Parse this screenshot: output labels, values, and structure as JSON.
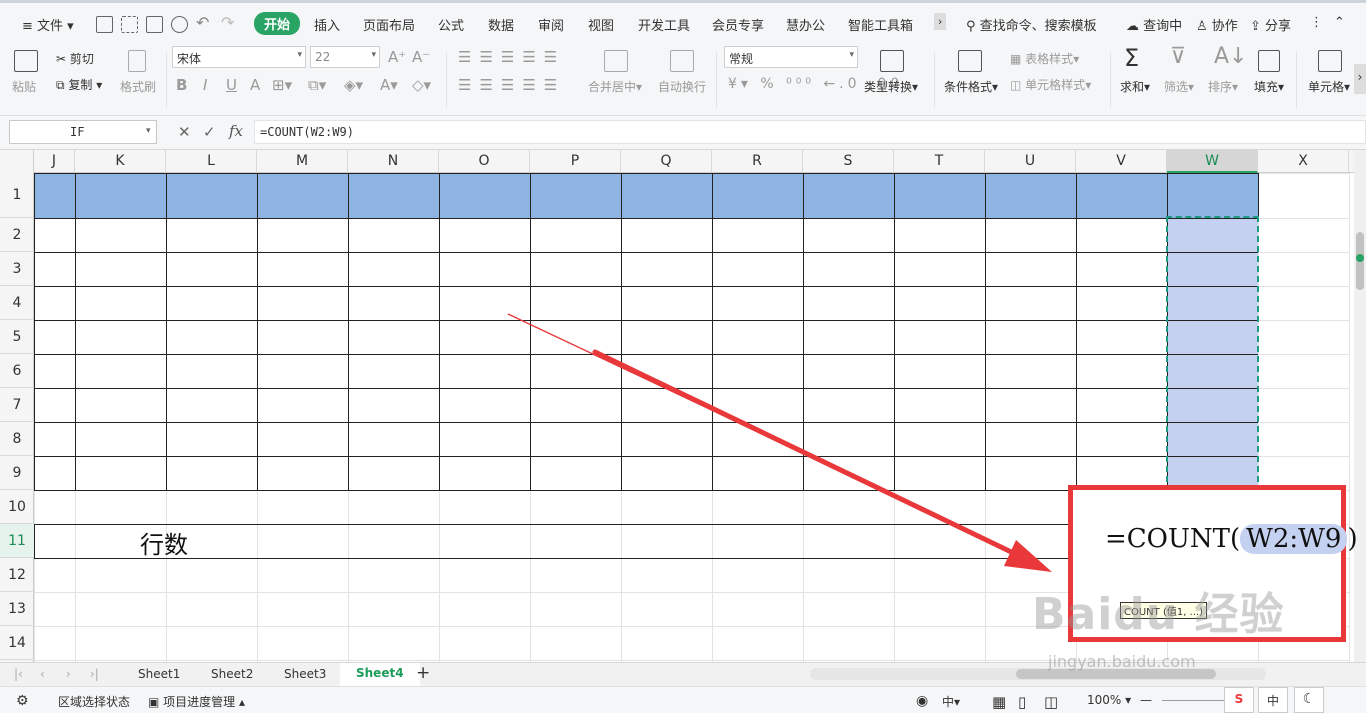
{
  "menu": {
    "file": "文件",
    "items": [
      "开始",
      "插入",
      "页面布局",
      "公式",
      "数据",
      "审阅",
      "视图",
      "开发工具",
      "会员专享",
      "慧办公",
      "智能工具箱"
    ],
    "search": "查找命令、搜索模板",
    "search_center": "查询中",
    "collab": "协作",
    "share": "分享"
  },
  "ribbon": {
    "paste": "粘贴",
    "cut": "剪切",
    "copy": "复制",
    "format_painter": "格式刷",
    "font": "宋体",
    "size": "22",
    "merge": "合并居中",
    "wrap": "自动换行",
    "numfmt": "常规",
    "type_convert": "类型转换",
    "cond_format": "条件格式",
    "table_style": "表格样式",
    "cell_style": "单元格样式",
    "sum": "求和",
    "filter": "筛选",
    "sort": "排序",
    "fill": "填充",
    "cell": "单元格"
  },
  "formula_bar": {
    "name_box": "IF",
    "fx": "fx",
    "formula": "=COUNT(W2:W9)"
  },
  "columns": [
    "J",
    "K",
    "L",
    "M",
    "N",
    "O",
    "P",
    "Q",
    "R",
    "S",
    "T",
    "U",
    "V",
    "W",
    "X"
  ],
  "rows": [
    "1",
    "2",
    "3",
    "4",
    "5",
    "6",
    "7",
    "8",
    "9",
    "10",
    "11",
    "12",
    "13",
    "14"
  ],
  "cell_text": {
    "row11": "行数"
  },
  "callout": {
    "formula_prefix": "=COUNT(",
    "formula_ref": "W2:W9",
    "formula_suffix": ")",
    "tooltip": "COUNT (值1, ...)"
  },
  "sheets": [
    "Sheet1",
    "Sheet2",
    "Sheet3",
    "Sheet4"
  ],
  "active_sheet": "Sheet4",
  "status": {
    "mode": "区域选择状态",
    "project": "项目进度管理",
    "zoom": "100%",
    "ime": "中"
  },
  "watermark": {
    "logo": "Baidu 经验",
    "url": "jingyan.baidu.com"
  },
  "colors": {
    "accent": "#2aa465",
    "header_fill": "#8eb4e3",
    "selection_fill": "#c5d1f0",
    "callout_border": "#e8383a"
  }
}
